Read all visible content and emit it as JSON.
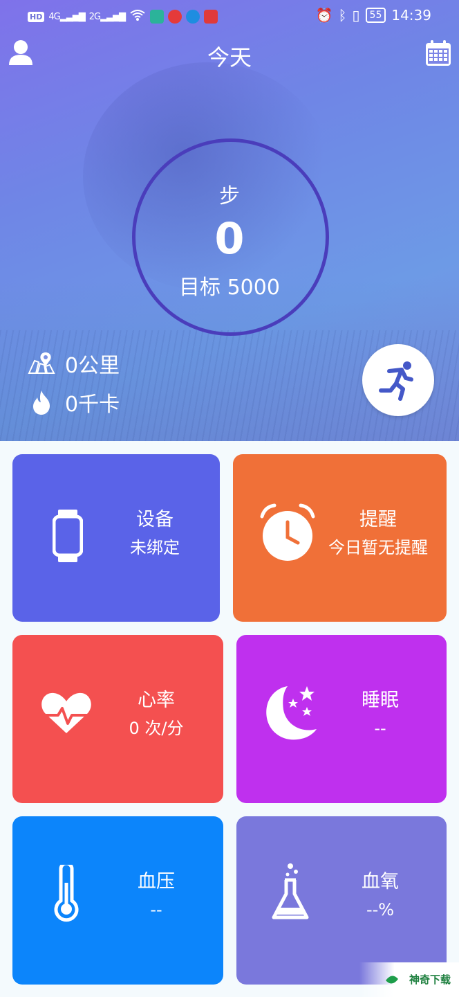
{
  "status_bar": {
    "left_chips": [
      "HD"
    ],
    "signal_1": "4G",
    "signal_2": "2G",
    "battery": "55",
    "time": "14:39"
  },
  "header": {
    "title": "今天",
    "left_icon": "user-icon",
    "right_icon": "calendar-icon"
  },
  "steps": {
    "unit": "步",
    "count": "0",
    "goal": "目标 5000",
    "goal_progress": 0.0
  },
  "stats": {
    "distance": "0公里",
    "calories": "0千卡"
  },
  "run_button": {
    "icon": "running-man-icon"
  },
  "cards": [
    {
      "name": "device",
      "title": "设备",
      "subtitle": "未绑定",
      "color": "#5a63e8",
      "icon": "watch-icon"
    },
    {
      "name": "reminder",
      "title": "提醒",
      "subtitle": "今日暂无提醒",
      "color": "#f07038",
      "icon": "alarm-clock-icon"
    },
    {
      "name": "heart-rate",
      "title": "心率",
      "subtitle": "0 次/分",
      "color": "#f45050",
      "icon": "heart-pulse-icon"
    },
    {
      "name": "sleep",
      "title": "睡眠",
      "subtitle": "--",
      "color": "#bf30ee",
      "icon": "moon-stars-icon"
    },
    {
      "name": "blood-pressure",
      "title": "血压",
      "subtitle": "--",
      "color": "#0c85fb",
      "icon": "thermometer-icon"
    },
    {
      "name": "blood-oxygen",
      "title": "血氧",
      "subtitle": "--%",
      "color": "#7a78dc",
      "icon": "flask-icon"
    }
  ],
  "watermark": {
    "text": "神奇下载"
  },
  "colors": {
    "ring": "#4a3dbb",
    "run_icon": "#4458c8"
  }
}
